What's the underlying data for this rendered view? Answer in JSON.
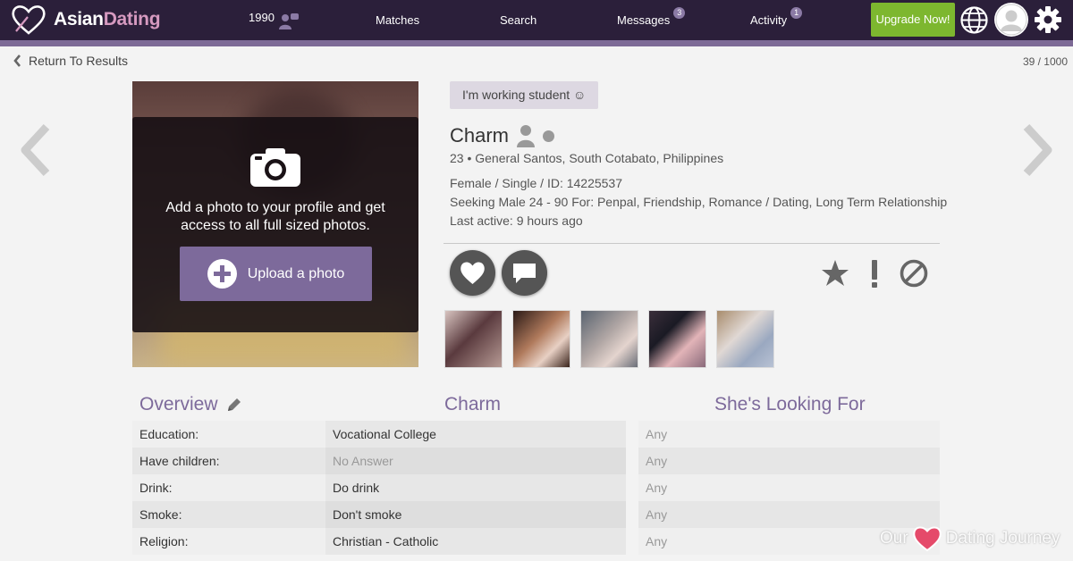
{
  "header": {
    "logo_main": "Asian",
    "logo_accent": "Dating",
    "nav": [
      {
        "label": "1990",
        "badge": ""
      },
      {
        "label": "Matches",
        "badge": ""
      },
      {
        "label": "Search",
        "badge": ""
      },
      {
        "label": "Messages",
        "badge": "3"
      },
      {
        "label": "Activity",
        "badge": "1"
      }
    ],
    "upgrade_label": "Upgrade Now!"
  },
  "subheader": {
    "back_label": "Return To Results",
    "result_count": "39 / 1000"
  },
  "photo": {
    "message": "Add a photo to your profile and get access to all full sized photos.",
    "upload_label": "Upload a photo"
  },
  "profile": {
    "tagline": "I'm working student ☺",
    "name": "Charm",
    "age_location": "23 • General Santos, South Cotabato, Philippines",
    "gender_status": "Female / Single / ID: 14225537",
    "seeking": "Seeking Male 24 - 90 For: Penpal, Friendship, Romance / Dating, Long Term Relationship",
    "last_active": "Last active: 9 hours ago"
  },
  "actions": {
    "like": "heart-icon",
    "message": "chat-icon",
    "favorite": "star-icon",
    "report": "exclamation-icon",
    "block": "block-icon"
  },
  "thumbnails": [
    {
      "color": "#7a5a5c"
    },
    {
      "color": "#5b3c2e"
    },
    {
      "color": "#8a8a8c"
    },
    {
      "color": "#6a4a58"
    },
    {
      "color": "#9aa0ab"
    }
  ],
  "overview": {
    "title": "Overview",
    "col_profile": "Charm",
    "col_looking": "She's Looking For",
    "rows": [
      {
        "label": "Education:",
        "value": "Vocational College",
        "want": "Any"
      },
      {
        "label": "Have children:",
        "value": "No Answer",
        "want": "Any"
      },
      {
        "label": "Drink:",
        "value": "Do drink",
        "want": "Any"
      },
      {
        "label": "Smoke:",
        "value": "Don't smoke",
        "want": "Any"
      },
      {
        "label": "Religion:",
        "value": "Christian - Catholic",
        "want": "Any"
      }
    ]
  },
  "watermark": {
    "left": "Our",
    "right": "Dating Journey"
  },
  "colors": {
    "header_bg": "#2b1f3a",
    "accent_purple": "#7d6a9b",
    "upgrade_green": "#7db72f"
  }
}
